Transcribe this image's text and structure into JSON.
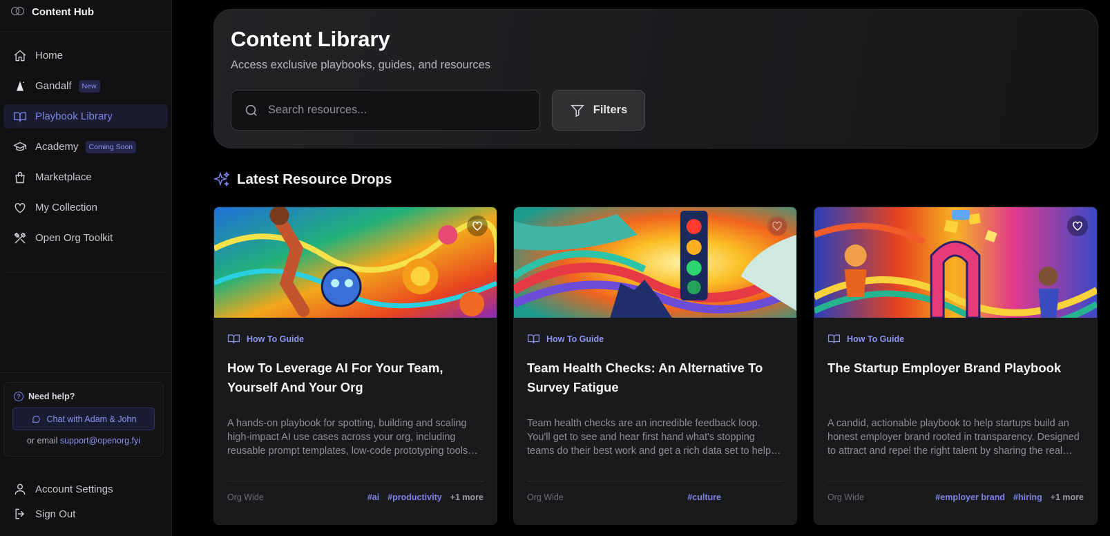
{
  "sidebar": {
    "brand": "Content Hub",
    "nav": [
      {
        "label": "Home",
        "icon": "home-icon"
      },
      {
        "label": "Gandalf",
        "icon": "wizard-hat-icon",
        "badge": "New"
      },
      {
        "label": "Playbook Library",
        "icon": "book-open-icon",
        "active": true
      },
      {
        "label": "Academy",
        "icon": "graduation-cap-icon",
        "badge": "Coming Soon"
      },
      {
        "label": "Marketplace",
        "icon": "shopping-bag-icon"
      },
      {
        "label": "My Collection",
        "icon": "heart-icon"
      },
      {
        "label": "Open Org Toolkit",
        "icon": "tools-icon"
      }
    ],
    "help": {
      "title": "Need help?",
      "chat_button": "Chat with Adam & John",
      "email_prefix": "or email",
      "email": "support@openorg.fyi"
    },
    "bottom": [
      {
        "label": "Account Settings",
        "icon": "user-icon"
      },
      {
        "label": "Sign Out",
        "icon": "sign-out-icon"
      }
    ]
  },
  "hero": {
    "title": "Content Library",
    "subtitle": "Access exclusive playbooks, guides, and resources",
    "search_placeholder": "Search resources...",
    "filters_label": "Filters"
  },
  "section": {
    "title": "Latest Resource Drops"
  },
  "cards": [
    {
      "type": "How To Guide",
      "title": "How To Leverage AI For Your Team, Yourself And Your Org",
      "description": "A hands-on playbook for spotting, building and scaling high-impact AI use cases across your org, including reusable prompt templates, low-code prototyping tools and more.",
      "scope": "Org Wide",
      "tags": [
        "#ai",
        "#productivity"
      ],
      "more": "+1 more"
    },
    {
      "type": "How To Guide",
      "title": "Team Health Checks: An Alternative To Survey Fatigue",
      "description": "Team health checks are an incredible feedback loop. You'll get to see and hear first hand what's stopping teams do their best work and get a rich data set to help you prioritise.",
      "scope": "Org Wide",
      "tags": [
        "#culture"
      ],
      "more": ""
    },
    {
      "type": "How To Guide",
      "title": "The Startup Employer Brand Playbook",
      "description": "A candid, actionable playbook to help startups build an honest employer brand rooted in transparency. Designed to attract and repel the right talent by sharing the real story.",
      "scope": "Org Wide",
      "tags": [
        "#employer brand",
        "#hiring"
      ],
      "more": "+1 more"
    }
  ],
  "colors": {
    "accent": "#7b83e8",
    "background": "#000000",
    "sidebar": "#111113",
    "card": "#1a1a1c"
  }
}
